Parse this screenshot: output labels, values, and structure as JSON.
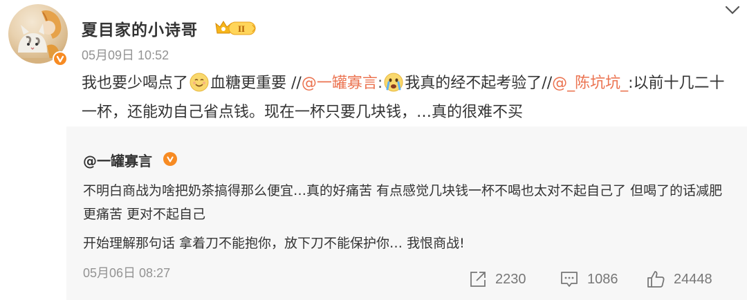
{
  "post": {
    "author": "夏目家的小诗哥",
    "level": "II",
    "time": "05月09日 10:52",
    "text": {
      "t1": "我也要少喝点了",
      "t2": "血糖更重要 //",
      "mention1": "@一罐寡言",
      "t3": ":",
      "t4": "我真的经不起考验了//",
      "mention2": "@_陈坑坑_",
      "t5": ":以前十几二十一杯，还能劝自己省点钱。现在一杯只要几块钱，…真的很难不买"
    },
    "emojis": [
      "smile-emoji",
      "crying-emoji"
    ]
  },
  "retweet": {
    "author": "@一罐寡言",
    "paragraph1": "不明白商战为啥把奶茶搞得那么便宜…真的好痛苦 有点感觉几块钱一杯不喝也太对不起自己了 但喝了的话减肥更痛苦 更对不起自己",
    "paragraph2": "开始理解那句话 拿着刀不能抱你，放下刀不能保护你… 我恨商战!",
    "time": "05月06日 08:27",
    "actions": {
      "share_count": "2230",
      "comment_count": "1086",
      "like_count": "24448"
    }
  },
  "colors": {
    "link": "#eb7350",
    "badge_orange": "#f78b23",
    "retweet_bg": "#f7f7f7",
    "meta_gray": "#939393"
  },
  "icons": [
    "chevron-down-icon",
    "verified-icon",
    "level-badge-icon",
    "share-icon",
    "comment-icon",
    "like-icon"
  ]
}
